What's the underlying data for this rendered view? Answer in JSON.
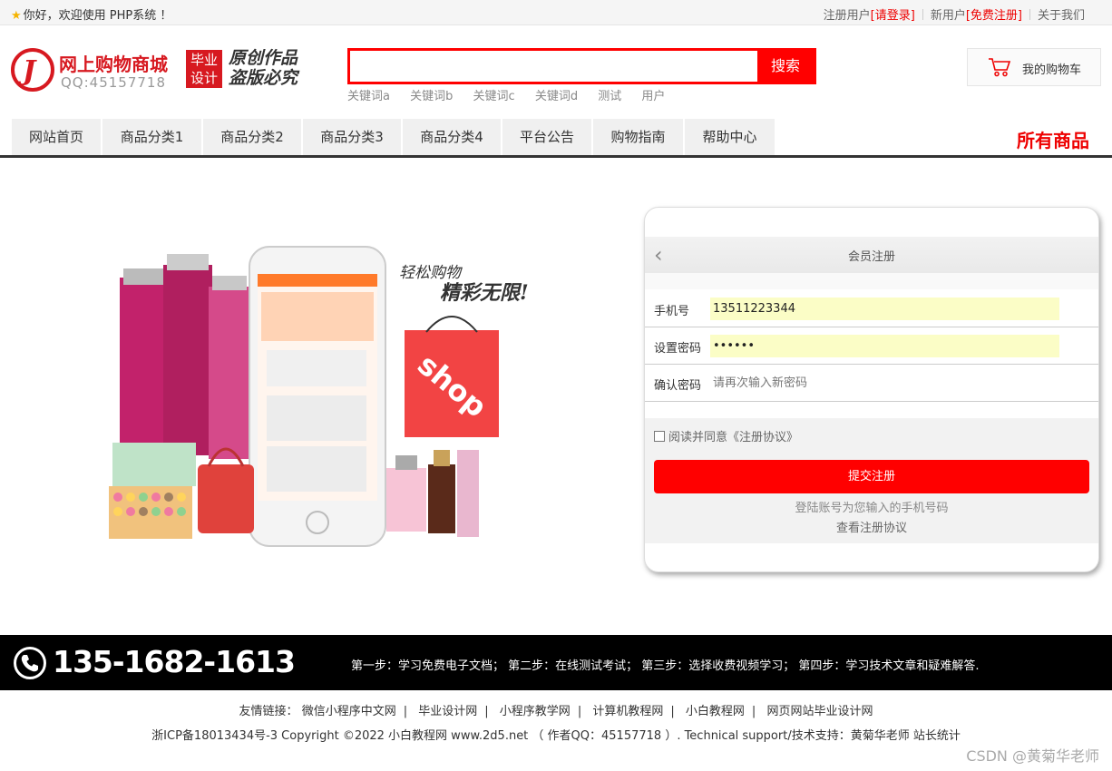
{
  "topbar": {
    "welcome": "你好，欢迎使用 PHP系统 ！",
    "registered_user": "注册用户",
    "login_link": "[请登录]",
    "new_user": "新用户",
    "register_link": "[免费注册]",
    "about": "关于我们"
  },
  "header": {
    "logo_title": "网上购物商城",
    "logo_qq": "QQ:45157718",
    "grad_line1": "毕业",
    "grad_line2": "设计",
    "slogan_line1": "原创作品",
    "slogan_line2": "盗版必究",
    "search_placeholder": "",
    "search_button": "搜索",
    "hotwords": [
      "关键词a",
      "关键词b",
      "关键词c",
      "关键词d",
      "测试",
      "用户"
    ],
    "cart_label": "我的购物车"
  },
  "nav": {
    "items": [
      "网站首页",
      "商品分类1",
      "商品分类2",
      "商品分类3",
      "商品分类4",
      "平台公告",
      "购物指南",
      "帮助中心"
    ],
    "all_goods": "所有商品"
  },
  "banner": {
    "slogan_top": "轻松购物",
    "slogan_bottom": "精彩无限!",
    "bag_text": "shop"
  },
  "register": {
    "title": "会员注册",
    "phone_label": "手机号",
    "phone_value": "13511223344",
    "password_label": "设置密码",
    "password_value": "••••••",
    "confirm_label": "确认密码",
    "confirm_placeholder": "请再次输入新密码",
    "agree_text": "阅读并同意《注册协议》",
    "submit": "提交注册",
    "hint": "登陆账号为您输入的手机号码",
    "view_agreement": "查看注册协议"
  },
  "footer": {
    "phone": "135-1682-1613",
    "steps": "第一步：学习免费电子文档；  第二步：在线测试考试；  第三步：选择收费视频学习；  第四步：学习技术文章和疑难解答.",
    "friend_label": "友情链接：",
    "friend_links": [
      "微信小程序中文网",
      "毕业设计网",
      "小程序教学网",
      "计算机教程网",
      "小白教程网",
      "网页网站毕业设计网"
    ],
    "copyright": "浙ICP备18013434号-3 Copyright ©2022 小白教程网 www.2d5.net （ 作者QQ：45157718 ）. Technical support/技术支持：黄菊华老师 站长统计",
    "watermark": "CSDN @黄菊华老师"
  }
}
